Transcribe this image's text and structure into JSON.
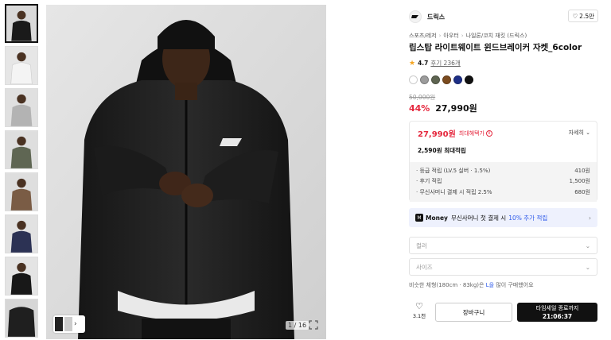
{
  "gallery": {
    "thumb_count": 8,
    "page_counter": "1 / 16",
    "color_dots": [
      "#f2f2f2",
      "#b9b9b9",
      "#5f6653",
      "#7a5c45",
      "#2c3254",
      "#111111"
    ]
  },
  "brand": {
    "name": "드릭스",
    "like_count": "2.5만"
  },
  "breadcrumb": [
    "스포츠/레저",
    "아우터",
    "나일론/코치 재킷 (드릭스)"
  ],
  "product": {
    "title": "립스탑 라이트웨이트 윈드브레이커 자켓_6color",
    "rating": "4.7",
    "reviews": "후기 236개",
    "swatches": [
      "#ffffff",
      "#9c9c9c",
      "#5e6451",
      "#7b4b1f",
      "#1e2f86",
      "#111111"
    ],
    "original_price": "50,000원",
    "discount": "44%",
    "price": "27,990원"
  },
  "benefits": {
    "max_price": "27,990원",
    "max_label": "최대혜택가",
    "detail_label": "자세히",
    "points_total": "2,590원 최대적립",
    "items": [
      {
        "label": "· 등급 적립 (LV.5 실버 · 1.5%)",
        "value": "410원"
      },
      {
        "label": "· 후기 적립",
        "value": "1,500원"
      },
      {
        "label": "· 무신사머니 결제 시 적립 2.5%",
        "value": "680원"
      }
    ]
  },
  "money_banner": {
    "brand": "Money",
    "text": "무신사머니 첫 결제 시",
    "highlight": "10% 추가 적립"
  },
  "options": {
    "color_placeholder": "컬러",
    "size_placeholder": "사이즈"
  },
  "size_tip": {
    "prefix": "비슷한 체형(180cm · 83kg)은",
    "size": "L을",
    "suffix": "많이 구매했어요"
  },
  "actions": {
    "wish_count": "3.1천",
    "cart": "장바구니",
    "buy_line1": "타임세일 종료까지",
    "buy_line2": "21:06:37"
  }
}
